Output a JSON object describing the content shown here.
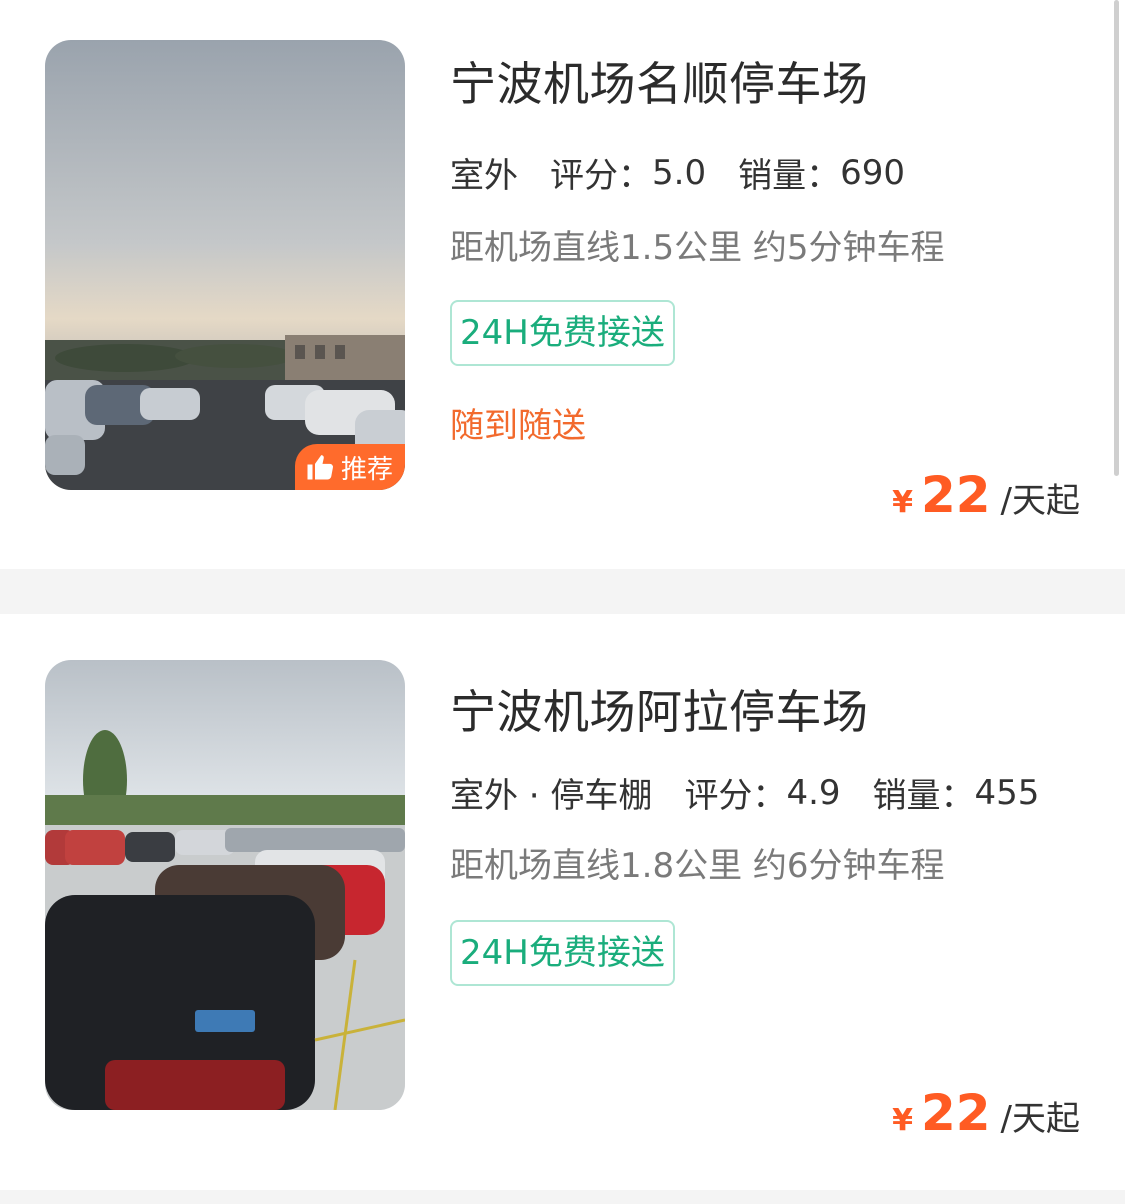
{
  "colors": {
    "accent_orange": "#ff5b23",
    "accent_green": "#1aad7c",
    "badge_bg": "#ff6b2c"
  },
  "listings": [
    {
      "name": "宁波机场名顺停车场",
      "type": "室外",
      "rating_label": "评分：",
      "rating": "5.0",
      "sales_label": "销量：",
      "sales": "690",
      "distance": "距机场直线1.5公里 约5分钟车程",
      "service_tag": "24H免费接送",
      "service_note": "随到随送",
      "badge_label": "推荐",
      "badge_icon": "thumbs-up-icon",
      "price_currency": "¥",
      "price": "22",
      "price_unit": "/天起"
    },
    {
      "name": "宁波机场阿拉停车场",
      "type": "室外 · 停车棚",
      "rating_label": "评分：",
      "rating": "4.9",
      "sales_label": "销量：",
      "sales": "455",
      "distance": "距机场直线1.8公里 约6分钟车程",
      "service_tag": "24H免费接送",
      "price_currency": "¥",
      "price": "22",
      "price_unit": "/天起"
    }
  ]
}
